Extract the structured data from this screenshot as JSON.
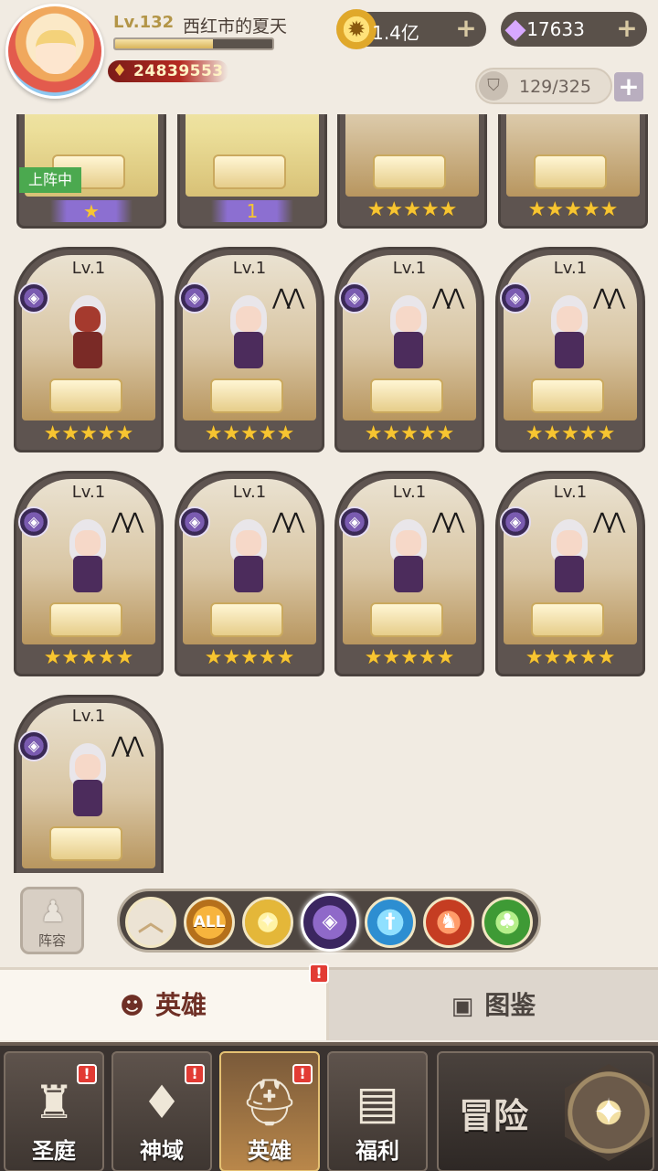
{
  "player": {
    "level": "Lv.132",
    "name": "西红市的夏天",
    "exp_fraction": 0.62,
    "power": "24839553"
  },
  "currencies": {
    "gold": "1.4亿",
    "gems": "17633"
  },
  "hero_count": "129/325",
  "cards": [
    {
      "level": "",
      "stars": "★",
      "badge": "上阵中",
      "wing": "★"
    },
    {
      "level": "",
      "stars": "1",
      "badge": "",
      "wing": "1"
    },
    {
      "level": "",
      "stars": "★★★★★",
      "badge": "",
      "wing": ""
    },
    {
      "level": "",
      "stars": "★★★★★",
      "badge": "",
      "wing": ""
    },
    {
      "level": "Lv.1",
      "stars": "★★★★★"
    },
    {
      "level": "Lv.1",
      "stars": "★★★★★"
    },
    {
      "level": "Lv.1",
      "stars": "★★★★★"
    },
    {
      "level": "Lv.1",
      "stars": "★★★★★"
    },
    {
      "level": "Lv.1",
      "stars": "★★★★★"
    },
    {
      "level": "Lv.1",
      "stars": "★★★★★"
    },
    {
      "level": "Lv.1",
      "stars": "★★★★★"
    },
    {
      "level": "Lv.1",
      "stars": "★★★★★"
    },
    {
      "level": "Lv.1",
      "stars": "★★★★★"
    }
  ],
  "filters": {
    "formation_label": "阵容",
    "all_label": "ALL",
    "selected": "dark"
  },
  "tabs": {
    "heroes": "英雄",
    "atlas": "图鉴",
    "badge": "!"
  },
  "nav": {
    "court": "圣庭",
    "divine": "神域",
    "heroes": "英雄",
    "welfare": "福利",
    "adventure": "冒险",
    "badge": "!"
  }
}
